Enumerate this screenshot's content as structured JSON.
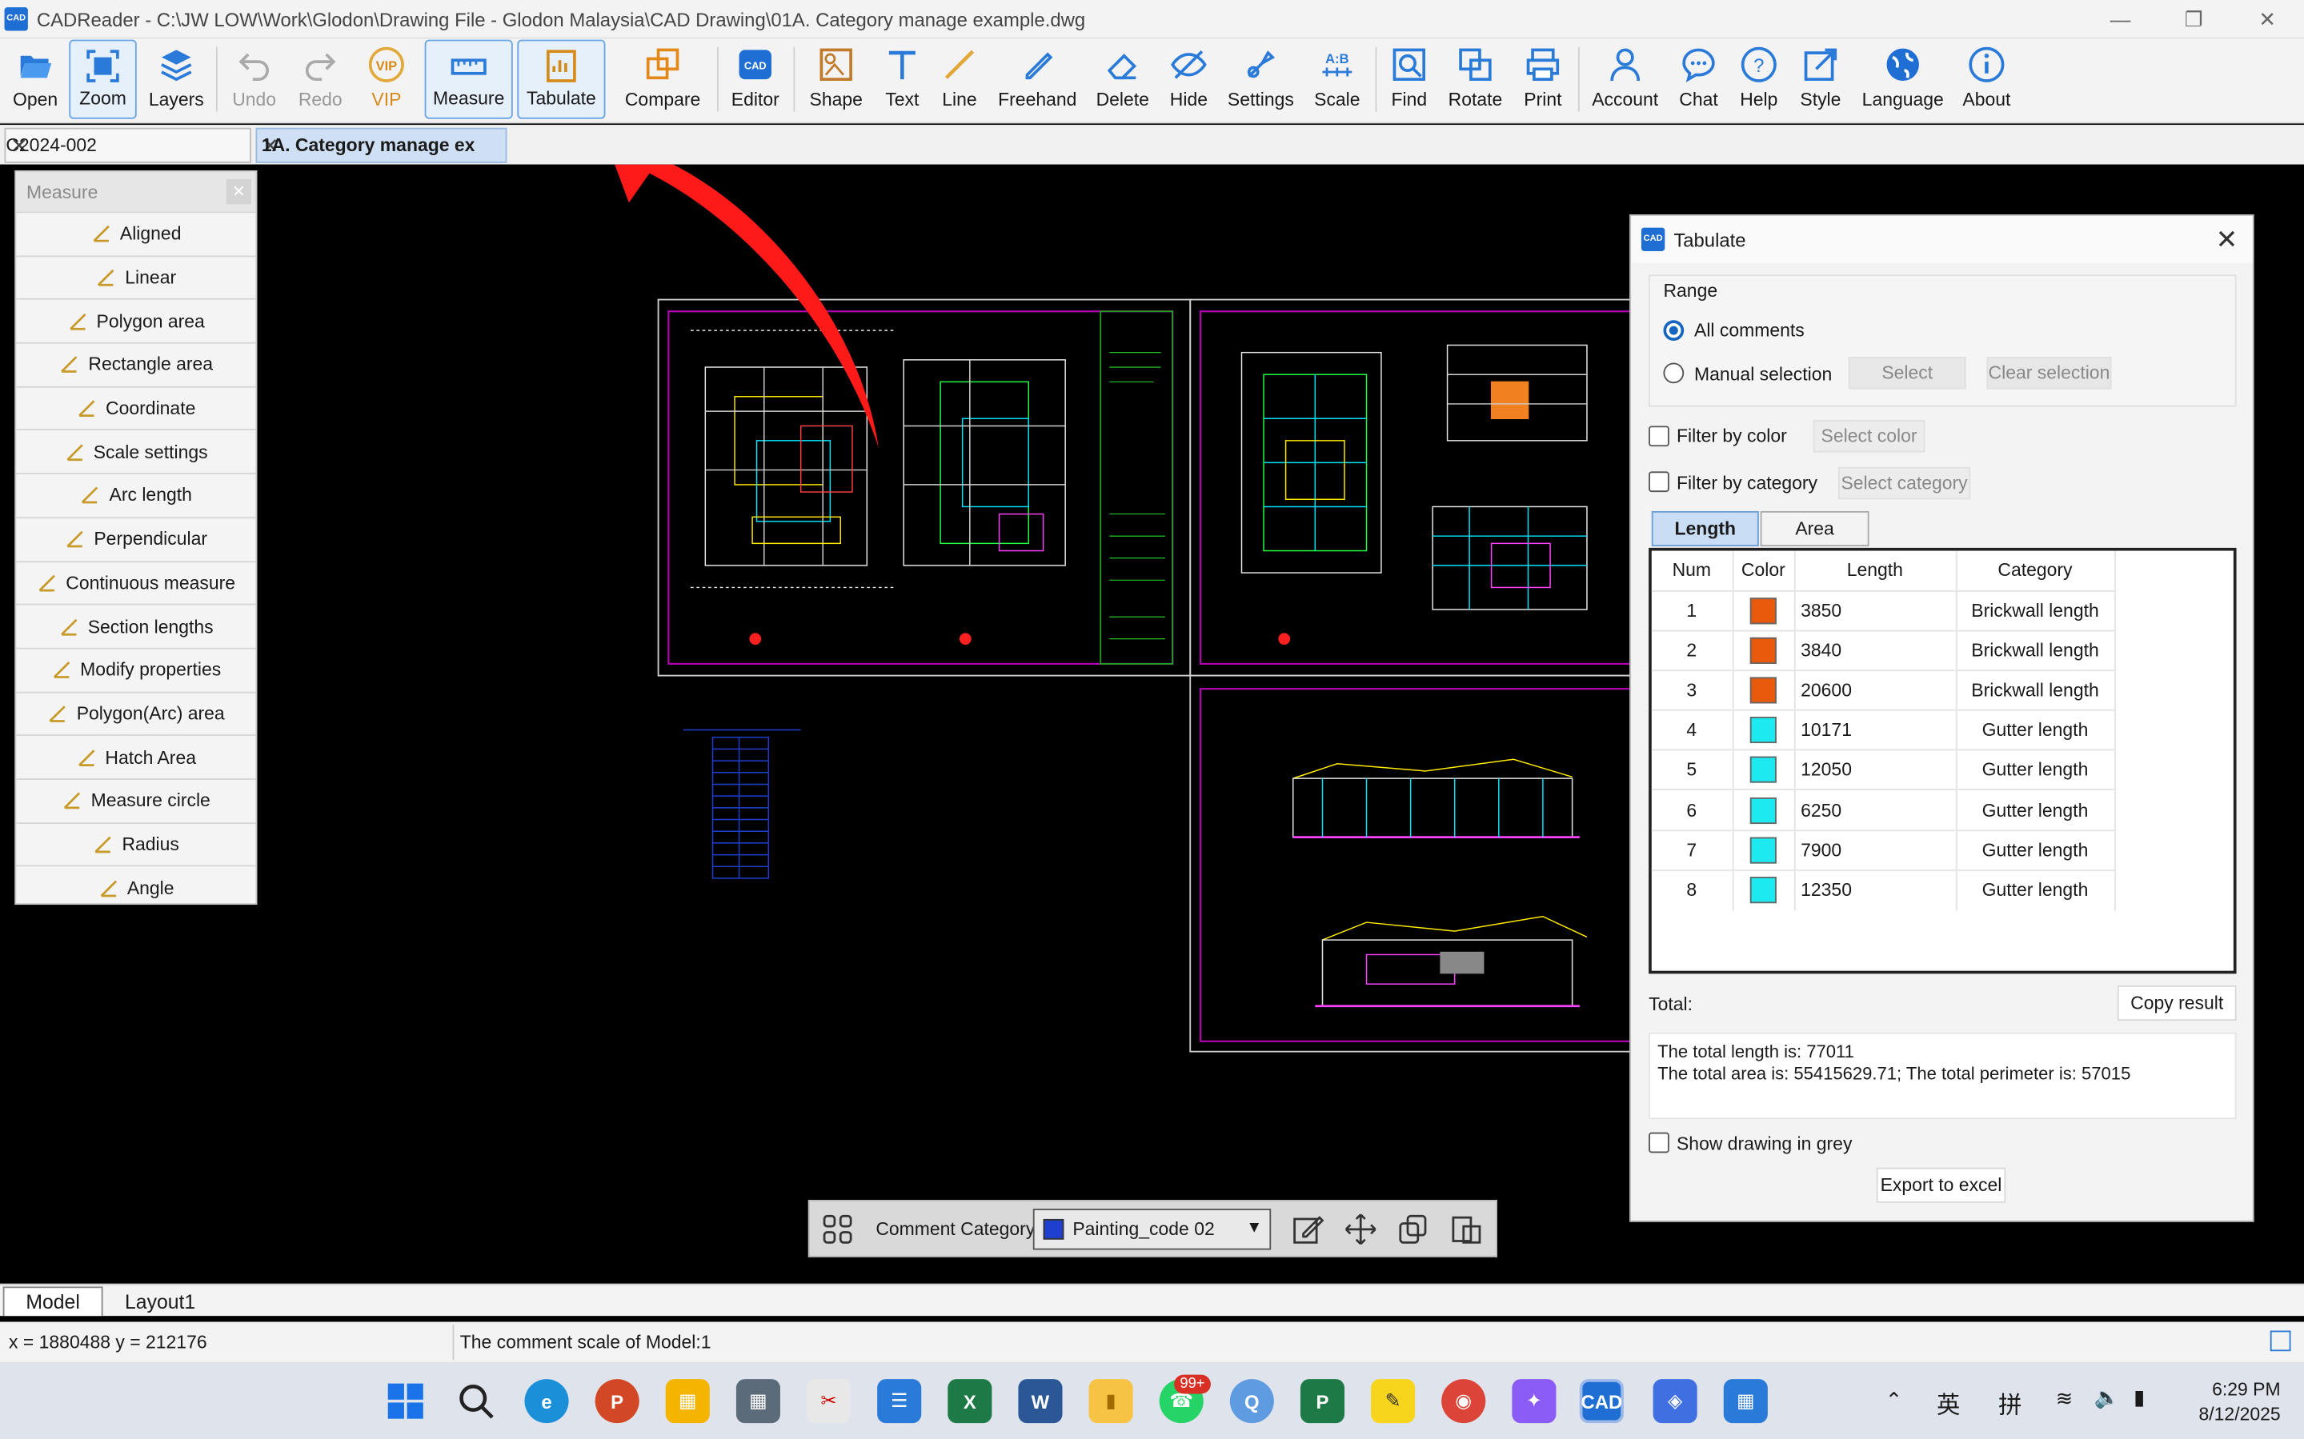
{
  "window": {
    "title": "CADReader - C:\\JW LOW\\Work\\Glodon\\Drawing File - Glodon Malaysia\\CAD Drawing\\01A. Category manage example.dwg",
    "app_logo": "CAD"
  },
  "toolbar": {
    "open": "Open",
    "zoom": "Zoom",
    "layers": "Layers",
    "undo": "Undo",
    "redo": "Redo",
    "vip": "VIP",
    "measure": "Measure",
    "tabulate": "Tabulate",
    "compare": "Compare",
    "editor": "Editor",
    "shape": "Shape",
    "text": "Text",
    "line": "Line",
    "freehand": "Freehand",
    "delete": "Delete",
    "hide": "Hide",
    "settings": "Settings",
    "scale": "Scale",
    "find": "Find",
    "rotate": "Rotate",
    "print": "Print",
    "account": "Account",
    "chat": "Chat",
    "help": "Help",
    "style": "Style",
    "language": "Language",
    "about": "About"
  },
  "tabs": [
    {
      "label": "C2024-002"
    },
    {
      "label": "1A. Category manage ex"
    }
  ],
  "measure_panel": {
    "title": "Measure",
    "items": [
      "Aligned",
      "Linear",
      "Polygon area",
      "Rectangle area",
      "Coordinate",
      "Scale settings",
      "Arc length",
      "Perpendicular",
      "Continuous measure",
      "Section lengths",
      "Modify properties",
      "Polygon(Arc) area",
      "Hatch Area",
      "Measure circle",
      "Radius",
      "Angle"
    ]
  },
  "tabulate": {
    "title": "Tabulate",
    "range_label": "Range",
    "all_comments": "All comments",
    "manual_selection": "Manual selection",
    "select_btn": "Select",
    "clear_selection_btn": "Clear selection",
    "filter_color": "Filter by color",
    "select_color": "Select color",
    "filter_category": "Filter by category",
    "select_category": "Select category",
    "tab_length": "Length",
    "tab_area": "Area",
    "columns": [
      "Num",
      "Color",
      "Length",
      "Category"
    ],
    "rows": [
      {
        "num": "1",
        "color": "#e8590c",
        "length": "3850",
        "category": "Brickwall length"
      },
      {
        "num": "2",
        "color": "#e8590c",
        "length": "3840",
        "category": "Brickwall length"
      },
      {
        "num": "3",
        "color": "#e8590c",
        "length": "20600",
        "category": "Brickwall length"
      },
      {
        "num": "4",
        "color": "#1de9f0",
        "length": "10171",
        "category": "Gutter length"
      },
      {
        "num": "5",
        "color": "#1de9f0",
        "length": "12050",
        "category": "Gutter length"
      },
      {
        "num": "6",
        "color": "#1de9f0",
        "length": "6250",
        "category": "Gutter length"
      },
      {
        "num": "7",
        "color": "#1de9f0",
        "length": "7900",
        "category": "Gutter length"
      },
      {
        "num": "8",
        "color": "#1de9f0",
        "length": "12350",
        "category": "Gutter length"
      }
    ],
    "total_label": "Total:",
    "copy_result": "Copy result",
    "result_line1": "The total length is: 77011",
    "result_line2": "The total area is: 55415629.71; The total perimeter is: 57015",
    "show_grey": "Show drawing in grey",
    "export": "Export to excel"
  },
  "comment_bar": {
    "label": "Comment Category",
    "selected": "Painting_code 02",
    "selected_color": "#1f3fd1"
  },
  "model_tabs": [
    "Model",
    "Layout1"
  ],
  "status": {
    "coords": "x = 1880488 y = 212176",
    "scale_msg": "The comment scale of Model:1"
  },
  "taskbar": {
    "whatsapp_badge": "99+",
    "ime1": "英",
    "ime2": "拼",
    "time": "6:29 PM",
    "date": "8/12/2025"
  },
  "colors": {
    "accent": "#1f6ed4",
    "arrow": "#ff1a1a",
    "drawing_frame": "#b000b0"
  }
}
